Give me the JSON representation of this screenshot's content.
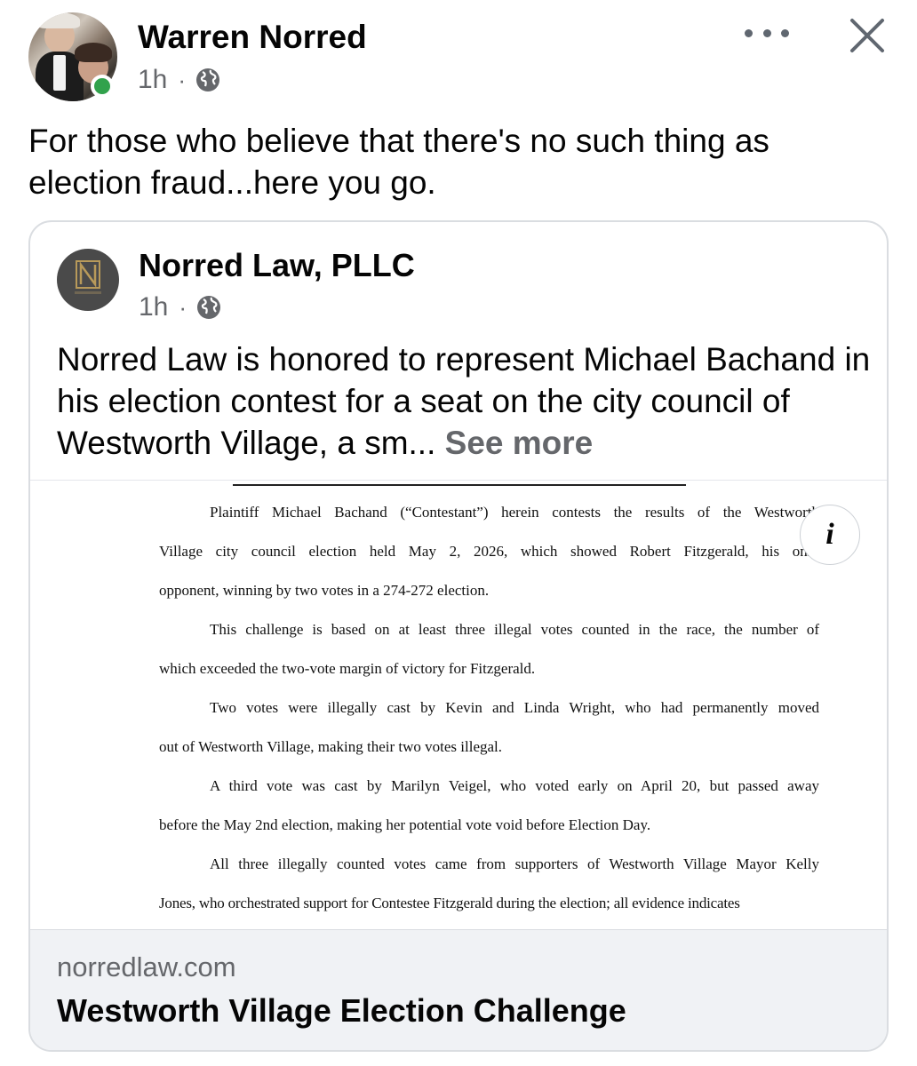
{
  "post": {
    "author_name": "Warren Norred",
    "time": "1h",
    "separator": "·",
    "privacy_icon": "globe-icon",
    "online_status_color": "#31a24c",
    "text": "For those who believe that there's no such thing as election fraud...here you go."
  },
  "header_actions": {
    "more_icon": "more-horizontal-icon",
    "close_icon": "close-icon"
  },
  "shared_post": {
    "page_name": "Norred Law, PLLC",
    "time": "1h",
    "separator": "·",
    "privacy_icon": "globe-icon",
    "text": "Norred Law is honored to represent Michael Bachand in his election contest for a seat on the city council of Westworth Village, a sm...",
    "see_more_label": "See more"
  },
  "link_preview": {
    "info_icon": "info-icon",
    "document_lines": [
      "Plaintiff Michael Bachand (“Contestant”) herein contests the results of the Westworth",
      "Village city council election held May 2, 2026, which showed Robert Fitzgerald, his only",
      "opponent, winning by two votes in a 274-272 election.",
      "This challenge is based on at least three illegal votes counted in the race, the number of",
      "which exceeded the two-vote margin of victory for Fitzgerald.",
      "Two votes were illegally cast by Kevin and Linda Wright, who had permanently moved",
      "out of Westworth Village, making their two votes illegal.",
      "A third vote was cast by Marilyn Veigel, who voted early on April 20, but passed away",
      "before the May 2nd election, making her potential vote void before Election Day.",
      "All three illegally counted votes came from supporters of Westworth Village Mayor Kelly",
      "Jones, who orchestrated support for Contestee Fitzgerald during the election; all evidence indicates"
    ],
    "domain": "norredlaw.com",
    "title": "Westworth Village Election Challenge"
  }
}
